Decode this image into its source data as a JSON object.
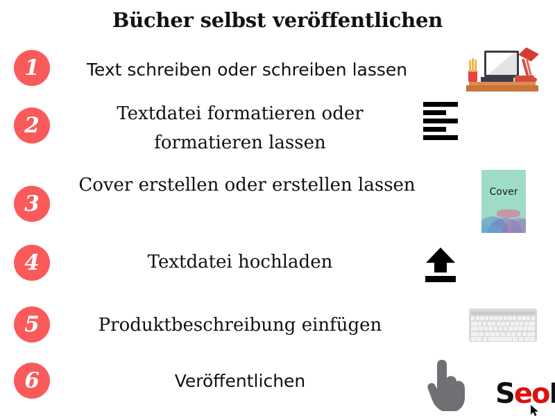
{
  "title": "Bücher selbst veröffentlichen",
  "theme": {
    "badge_color": "#fa5a5a",
    "badge_text_color": "#ffffff",
    "text_color": "#101010",
    "background": "#ffffff",
    "cover_color": "#9fdcc8",
    "logo_accent": "#dd1111"
  },
  "steps": [
    {
      "number": "1",
      "label": "Text schreiben oder schreiben lassen",
      "icon": "desk-laptop-icon"
    },
    {
      "number": "2",
      "label": "Textdatei formatieren oder formatieren lassen",
      "icon": "text-format-lines-icon"
    },
    {
      "number": "3",
      "label": "Cover erstellen oder erstellen lassen",
      "icon": "book-cover-icon"
    },
    {
      "number": "4",
      "label": "Textdatei hochladen",
      "icon": "upload-arrow-icon"
    },
    {
      "number": "5",
      "label": "Produktbeschreibung einfügen",
      "icon": "keyboard-icon"
    },
    {
      "number": "6",
      "label": "Veröffentlichen",
      "icon": "pointing-hand-icon"
    }
  ],
  "cover": {
    "caption": "Cover"
  },
  "logo": {
    "part1": "S",
    "part2": "eo",
    "part3": "K"
  }
}
